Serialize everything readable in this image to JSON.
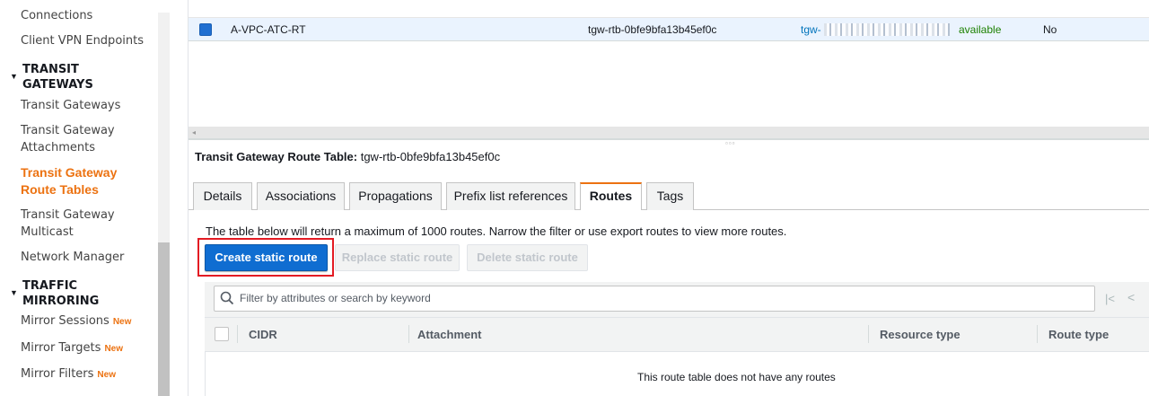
{
  "sidebar": {
    "items_top": [
      {
        "label": "Connections"
      },
      {
        "label": "Client VPN Endpoints"
      }
    ],
    "section_transit": "TRANSIT GATEWAYS",
    "transit_items": [
      {
        "label": "Transit Gateways"
      },
      {
        "label": "Transit Gateway Attachments"
      },
      {
        "label": "Transit Gateway Route Tables"
      },
      {
        "label": "Transit Gateway Multicast"
      },
      {
        "label": "Network Manager"
      }
    ],
    "section_mirroring": "TRAFFIC MIRRORING",
    "mirroring_items": [
      {
        "label": "Mirror Sessions",
        "badge": "New"
      },
      {
        "label": "Mirror Targets",
        "badge": "New"
      },
      {
        "label": "Mirror Filters",
        "badge": "New"
      }
    ],
    "active_color": "#ec7211"
  },
  "route_table_list": {
    "selected_row": {
      "name": "A-VPC-ATC-RT",
      "route_table_id": "tgw-rtb-0bfe9bfa13b45ef0c",
      "transit_gateway_id": "tgw-",
      "state": "available",
      "default_association": "No"
    }
  },
  "detail": {
    "title_label": "Transit Gateway Route Table:",
    "title_value": "tgw-rtb-0bfe9bfa13b45ef0c",
    "tabs": [
      {
        "label": "Details"
      },
      {
        "label": "Associations"
      },
      {
        "label": "Propagations"
      },
      {
        "label": "Prefix list references"
      },
      {
        "label": "Routes",
        "active": true
      },
      {
        "label": "Tags"
      }
    ],
    "info": "The table below will return a maximum of 1000 routes. Narrow the filter or use export routes to view more routes.",
    "buttons": {
      "create": "Create static route",
      "replace": "Replace static route",
      "delete": "Delete static route"
    },
    "filter_placeholder": "Filter by attributes or search by keyword",
    "columns": [
      "CIDR",
      "Attachment",
      "Resource type",
      "Route type"
    ],
    "empty_message": "This route table does not have any routes",
    "pager": {
      "first": "|<",
      "prev": "<"
    }
  },
  "colors": {
    "primary_button": "#0f6dd1",
    "highlight": "#e31b23",
    "available": "#1d8102",
    "link": "#0073bb"
  },
  "icons": [
    "search-icon",
    "caret-down-icon",
    "checkbox-icon",
    "first-page-icon",
    "prev-page-icon"
  ]
}
